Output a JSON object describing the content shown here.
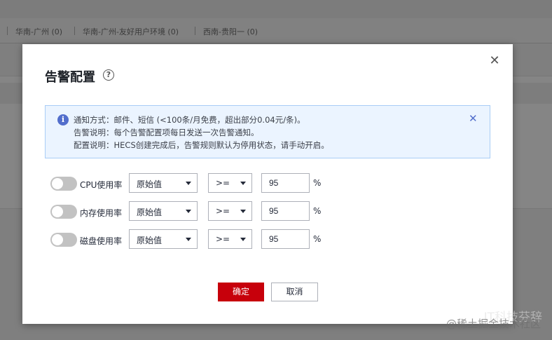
{
  "background": {
    "regions": [
      "华南-广州 (0)",
      "华南-广州-友好用户环境 (0)",
      "西南-贵阳一 (0)"
    ]
  },
  "dialog": {
    "title": "告警配置",
    "help_icon": "help-icon",
    "close_icon": "close-icon",
    "info": {
      "icon": "info-icon",
      "lines": [
        "通知方式：邮件、短信 (<100条/月免费，超出部分0.04元/条)。",
        "告警说明：每个告警配置项每日发送一次告警通知。",
        "配置说明：HECS创建完成后，告警规则默认为停用状态，请手动开启。"
      ]
    },
    "rules": [
      {
        "label": "CPU使用率",
        "enabled": false,
        "mode": "原始值",
        "operator": ">=",
        "threshold": "95",
        "unit": "%"
      },
      {
        "label": "内存使用率",
        "enabled": false,
        "mode": "原始值",
        "operator": ">=",
        "threshold": "95",
        "unit": "%"
      },
      {
        "label": "磁盘使用率",
        "enabled": false,
        "mode": "原始值",
        "operator": ">=",
        "threshold": "95",
        "unit": "%"
      }
    ],
    "confirm_label": "确定",
    "cancel_label": "取消"
  },
  "watermark": "IT科技芬辞",
  "watermark_sub": "@稀土掘金技术社区",
  "colors": {
    "primary": "#c7000b",
    "info_bg": "#ebf4ff",
    "info_border": "#a9cdf6",
    "toggle_off": "#c2c2c2"
  }
}
